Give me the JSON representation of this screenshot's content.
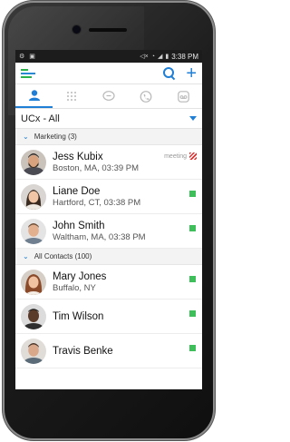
{
  "status_bar": {
    "time": "3:38 PM"
  },
  "filter": {
    "label": "UCx - All"
  },
  "groups": [
    {
      "label": "Marketing (3)",
      "contacts": [
        {
          "name": "Jess Kubix",
          "detail": "Boston, MA, 03:39 PM",
          "status": "meeting",
          "status_label": "meeting"
        },
        {
          "name": "Liane Doe",
          "detail": "Hartford, CT, 03:38 PM",
          "status": "available"
        },
        {
          "name": "John Smith",
          "detail": "Waltham, MA, 03:38 PM",
          "status": "available"
        }
      ]
    },
    {
      "label": "All Contacts (100)",
      "contacts": [
        {
          "name": "Mary Jones",
          "detail": "Buffalo, NY",
          "status": "available"
        },
        {
          "name": "Tim Wilson",
          "detail": "",
          "status": "available"
        },
        {
          "name": "Travis Benke",
          "detail": "",
          "status": "available"
        }
      ]
    }
  ],
  "icons": {
    "logo": "app-logo-icon",
    "search": "search-icon",
    "add": "plus-icon",
    "tabs": [
      "contacts-icon",
      "dialpad-icon",
      "chat-icon",
      "call-history-icon",
      "voicemail-icon"
    ]
  },
  "colors": {
    "accent": "#1f7fd6",
    "available": "#3fbf5a",
    "meeting": "#e03030",
    "brand_green": "#27b34a"
  }
}
